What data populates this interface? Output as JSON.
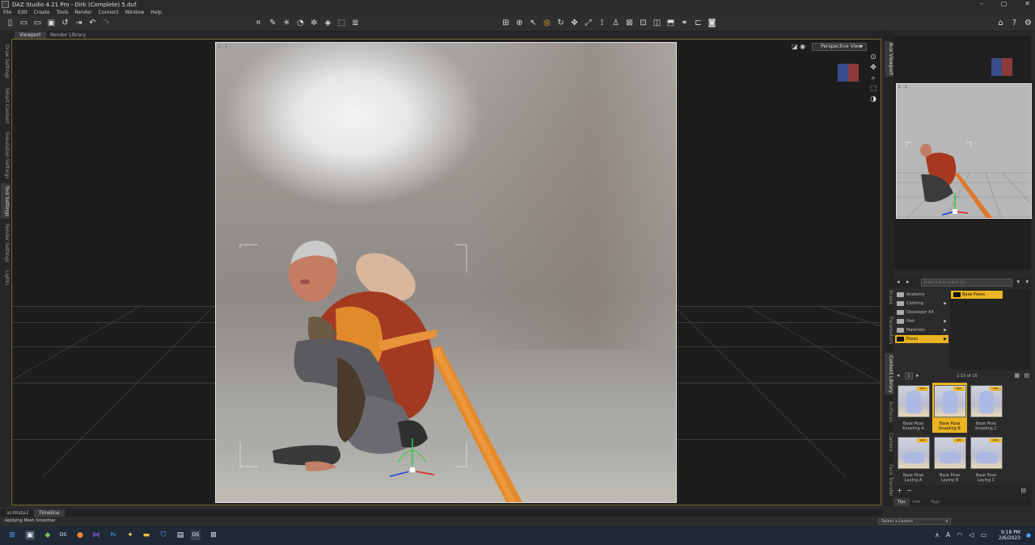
{
  "window": {
    "title": "DAZ Studio 4.21 Pro - Dirk (Complete) 5.duf",
    "controls": [
      "–",
      "▢",
      "✕"
    ]
  },
  "menu": [
    "File",
    "Edit",
    "Create",
    "Tools",
    "Render",
    "Connect",
    "Window",
    "Help"
  ],
  "toolbar": {
    "file_icons": [
      "new-icon",
      "open-icon",
      "open-recent-icon",
      "save-icon",
      "revert-icon",
      "export-icon",
      "undo-icon",
      "redo-icon"
    ],
    "tool_icons": [
      "universal-tool-icon",
      "selection-tool-icon",
      "active-pose-icon",
      "rotate-icon",
      "translate-icon",
      "scale-icon",
      "joint-editor-icon",
      "surface-selection-icon",
      "geometry-editor-icon",
      "node-weight-icon",
      "region-nav-icon",
      "spot-render-icon"
    ]
  },
  "viewport_tabs": [
    "Viewport",
    "Render Library"
  ],
  "left_tabs": [
    "Draw Settings",
    "Smart Content",
    "Simulation Settings",
    "Tool Settings",
    "Render Settings",
    "Lights"
  ],
  "viewport": {
    "corner_label": "1 : 1",
    "view_select": "Perspective View",
    "nav_icons": [
      "orbit-icon",
      "pan-icon",
      "zoom-icon",
      "frame-icon",
      "reset-icon"
    ]
  },
  "aux_viewport": {
    "tab": "Aux Viewport",
    "corner_label": "1 : 1"
  },
  "right_tabs": [
    "Scene",
    "Parameters",
    "Content Library",
    "Surfaces",
    "Camera",
    "Face Transfer"
  ],
  "content_library": {
    "search_placeholder": "Enter text to search by...",
    "tree": [
      {
        "label": "Anatomy",
        "arrow": ""
      },
      {
        "label": "Clothing",
        "arrow": "▶"
      },
      {
        "label": "Developer Kit",
        "arrow": ""
      },
      {
        "label": "Hair",
        "arrow": "▶"
      },
      {
        "label": "Materials",
        "arrow": "▶"
      },
      {
        "label": "Poses",
        "arrow": "▶"
      }
    ],
    "sub_selected": "Base Poses",
    "page_label": "1-15 of 15",
    "page_num": "1",
    "items": [
      {
        "label": "Base Pose Kneeling A",
        "badge": "DZ9"
      },
      {
        "label": "Base Pose Kneeling B",
        "badge": "DZ9"
      },
      {
        "label": "Base Pose Kneeling C",
        "badge": "DZ9"
      },
      {
        "label": "Base Pose Laying A",
        "badge": "DZ9"
      },
      {
        "label": "Base Pose Laying B",
        "badge": "DZ9"
      },
      {
        "label": "Base Pose Laying C",
        "badge": "DZ9"
      }
    ],
    "bottom_tabs": [
      "Tips",
      "Info",
      "Tags"
    ]
  },
  "bottom_tabs": [
    "aniMate2",
    "Timeline"
  ],
  "status": {
    "message": "Applying Mesh Smoother",
    "lesson_select": "Select a Lesson"
  },
  "taskbar": {
    "time": "9:18 PM",
    "date": "2/6/2023"
  }
}
